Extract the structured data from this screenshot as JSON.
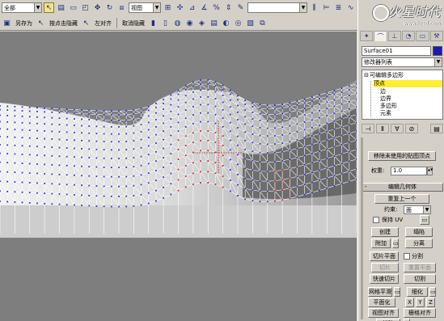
{
  "toolbar": {
    "selection_filter": "全部",
    "ref_coord": "视图",
    "named_sets": "",
    "save_as": "另存为",
    "hide_by_element": "按点击隐藏",
    "left_align": "左对齐",
    "unhide": "取消隐藏"
  },
  "watermark": {
    "brand": "火星时代",
    "url": "www.hxsd.com"
  },
  "command_panel": {
    "object_name": "Surface01",
    "object_color": "#1a1ab0",
    "modifier_list": "修改器列表",
    "stack": {
      "root": "可编辑多边形",
      "items": [
        "顶点",
        "边",
        "边界",
        "多边形",
        "元素"
      ],
      "selected": "顶点"
    },
    "remove_unused_map_verts": "移除未使用的贴图顶点",
    "weight_label": "权重:",
    "weight_value": "1.0",
    "rollout_edit_geometry": "编辑几何体",
    "rollout_collapse_symbol": "-",
    "repeat_last": "重复上一个",
    "constraints_label": "约束:",
    "constraints_value": "面",
    "preserve_uvs": "保持 UV",
    "create": "创建",
    "collapse": "塌陷",
    "attach": "附加",
    "detach": "分离",
    "slice_plane": "切片平面",
    "split": "分割",
    "slice": "切片",
    "reset_plane": "重置平面",
    "quickslice": "快速切片",
    "cut": "切割",
    "msmooth": "网格平滑",
    "tessellate": "细化",
    "make_planar": "平面化",
    "x": "X",
    "y": "Y",
    "z": "Z",
    "view_align": "视图对齐",
    "grid_align": "栅格对齐",
    "relax": "松弛"
  },
  "colors": {
    "viewport_bg": "#7e7e7e",
    "selection_highlight": "#ffee33",
    "vertex": "#2233cc",
    "selected_vertex": "#d42020"
  }
}
